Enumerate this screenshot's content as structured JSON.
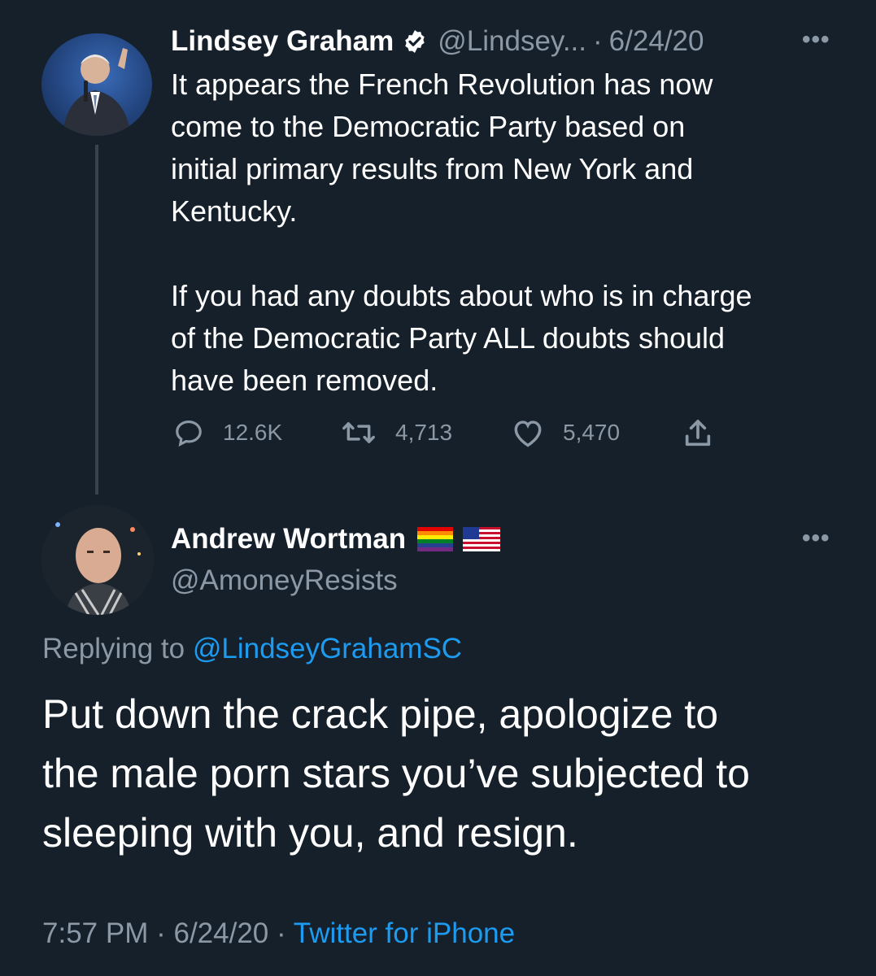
{
  "parent_tweet": {
    "author_name": "Lindsey Graham",
    "handle": "@Lindsey...",
    "separator": "·",
    "date": "6/24/20",
    "more_icon": "more-horizontal-icon",
    "verified_icon": "verified-badge-icon",
    "text_lines": [
      "It appears the French Revolution has now",
      "come to the Democratic Party based on",
      "initial primary results from New York and",
      "Kentucky.",
      "",
      "If you had any doubts about who is in charge",
      "of the Democratic Party ALL doubts should",
      "have been removed."
    ],
    "actions": {
      "replies": "12.6K",
      "retweets": "4,713",
      "likes": "5,470"
    }
  },
  "reply_tweet": {
    "author_name": "Andrew Wortman",
    "handle": "@AmoneyResists",
    "name_emojis": [
      "rainbow-flag-icon",
      "us-flag-icon"
    ],
    "more_icon": "more-horizontal-icon",
    "replying_to_label": "Replying to",
    "replying_to_handle": "@LindseyGrahamSC",
    "text_lines": [
      "Put down the crack pipe, apologize to",
      "the male porn stars you’ve subjected to",
      "sleeping with you, and resign."
    ],
    "time": "7:57 PM",
    "separator": "·",
    "date": "6/24/20",
    "source": "Twitter for iPhone"
  },
  "colors": {
    "background": "#15202b",
    "text": "#ffffff",
    "muted": "#8b98a5",
    "accent": "#1d9bf0",
    "thread_line": "#38444d"
  }
}
